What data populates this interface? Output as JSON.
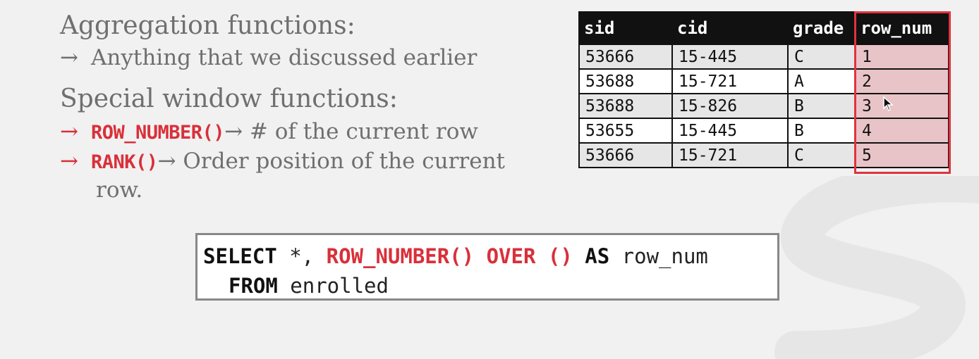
{
  "left": {
    "heading1": "Aggregation functions:",
    "bullet1": "Anything that we discussed earlier",
    "heading2": "Special window functions:",
    "bullet2_fn": "ROW_NUMBER()",
    "bullet2_text": "→ # of the current row",
    "bullet3_fn": "RANK()",
    "bullet3_text": "→ Order position of the current",
    "bullet3_cont": "row.",
    "arrow": "→"
  },
  "table": {
    "headers": [
      "sid",
      "cid",
      "grade",
      "row_num"
    ],
    "rows": [
      [
        "53666",
        "15-445",
        "C",
        "1"
      ],
      [
        "53688",
        "15-721",
        "A",
        "2"
      ],
      [
        "53688",
        "15-826",
        "B",
        "3"
      ],
      [
        "53655",
        "15-445",
        "B",
        "4"
      ],
      [
        "53666",
        "15-721",
        "C",
        "5"
      ]
    ],
    "highlight_column": "row_num",
    "highlight_color": "#e0343d"
  },
  "sql": {
    "select": "SELECT",
    "star": " *, ",
    "fn": "ROW_NUMBER() OVER ()",
    "as": " AS",
    "alias": " row_num",
    "from": "FROM",
    "table": " enrolled"
  },
  "colors": {
    "accent": "#d9303a",
    "text_gray": "#6f6f6f",
    "background": "#f1f1f1"
  },
  "icons": [
    "mouse-cursor-icon"
  ]
}
